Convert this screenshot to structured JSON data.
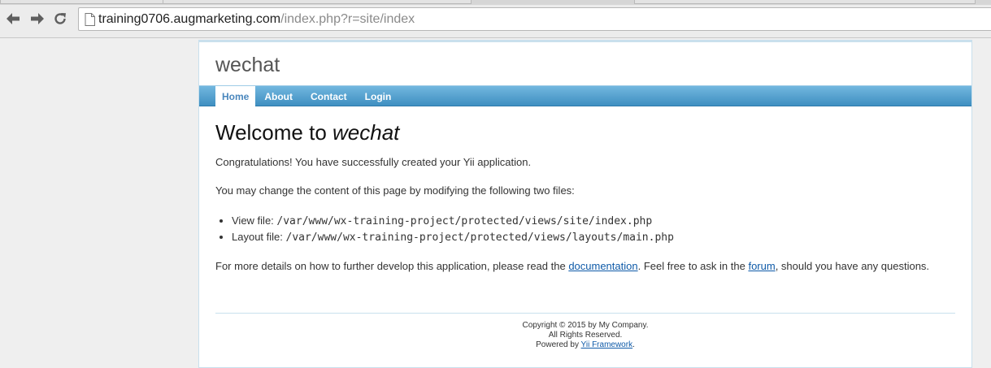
{
  "browser": {
    "url_host": "training0706.augmarketing.com",
    "url_path": "/index.php?r=site/index",
    "icons": [
      "back-arrow-icon",
      "forward-arrow-icon",
      "reload-icon",
      "page-icon"
    ]
  },
  "site": {
    "name": "wechat",
    "accent_color": "#4a9acb"
  },
  "menu": {
    "items": [
      {
        "label": "Home",
        "active": true
      },
      {
        "label": "About",
        "active": false
      },
      {
        "label": "Contact",
        "active": false
      },
      {
        "label": "Login",
        "active": false
      }
    ]
  },
  "content": {
    "heading_prefix": "Welcome to ",
    "heading_name": "wechat",
    "congrats": "Congratulations! You have successfully created your Yii application.",
    "change_intro": "You may change the content of this page by modifying the following two files:",
    "files": [
      {
        "label": "View file: ",
        "path": "/var/www/wx-training-project/protected/views/site/index.php"
      },
      {
        "label": "Layout file: ",
        "path": "/var/www/wx-training-project/protected/views/layouts/main.php"
      }
    ],
    "details_before": "For more details on how to further develop this application, please read the ",
    "docs_link": "documentation",
    "details_middle": ". Feel free to ask in the ",
    "forum_link": "forum",
    "details_after": ", should you have any questions."
  },
  "footer": {
    "copyright": "Copyright © 2015 by My Company.",
    "rights": "All Rights Reserved.",
    "powered_prefix": "Powered by ",
    "powered_link": "Yii Framework",
    "powered_suffix": "."
  }
}
